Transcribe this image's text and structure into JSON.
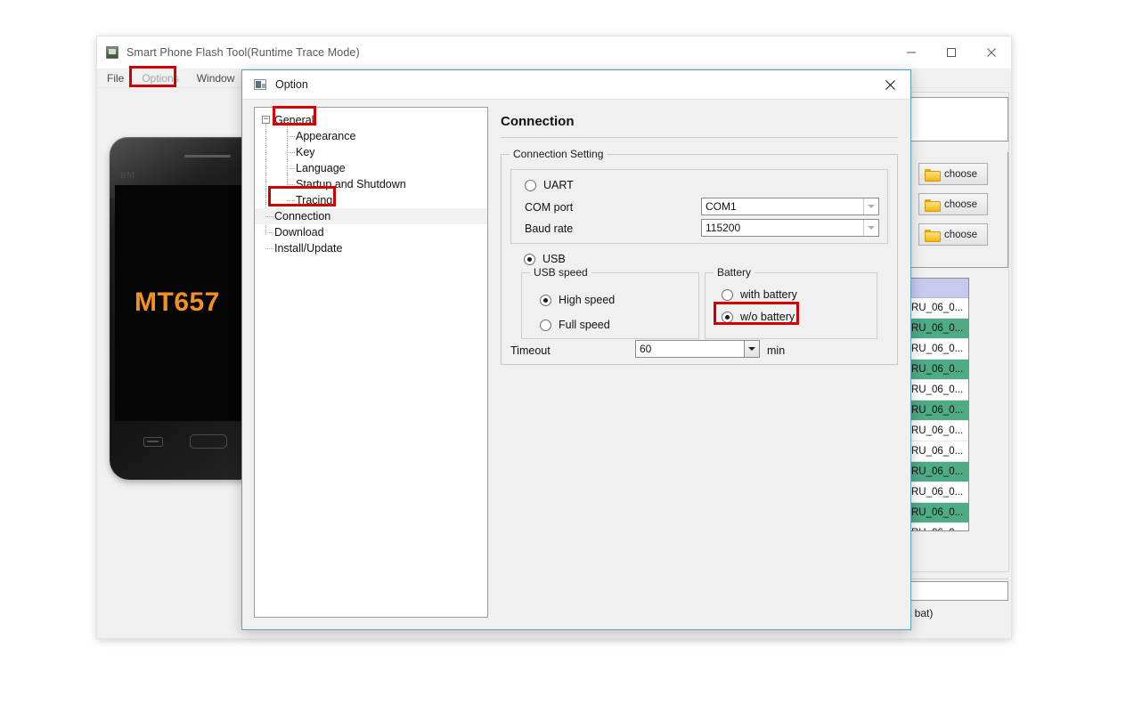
{
  "main_window": {
    "title": "Smart Phone Flash Tool(Runtime Trace Mode)",
    "icon": "app-icon",
    "controls": {
      "minimize": "minimize-icon",
      "maximize": "maximize-icon",
      "close": "close-icon"
    },
    "menu": [
      {
        "label": "File",
        "state": "normal"
      },
      {
        "label": "Options",
        "state": "active-highlighted"
      },
      {
        "label": "Window",
        "state": "normal"
      }
    ],
    "phone": {
      "brand": "BM",
      "model_text": "MT657"
    },
    "right_panel": {
      "choose_buttons": [
        {
          "label": "choose",
          "icon": "folder-icon"
        },
        {
          "label": "choose",
          "icon": "folder-icon"
        },
        {
          "label": "choose",
          "icon": "folder-icon"
        }
      ],
      "list_rows": [
        {
          "text": "RU_06_0...",
          "highlight": "white"
        },
        {
          "text": "RU_06_0...",
          "highlight": "green"
        },
        {
          "text": "RU_06_0...",
          "highlight": "white"
        },
        {
          "text": "RU_06_0...",
          "highlight": "green"
        },
        {
          "text": "RU_06_0...",
          "highlight": "white"
        },
        {
          "text": "RU_06_0...",
          "highlight": "green"
        },
        {
          "text": "RU_06_0...",
          "highlight": "white"
        },
        {
          "text": "RU_06_0...",
          "highlight": "white"
        },
        {
          "text": "RU_06_0...",
          "highlight": "green"
        },
        {
          "text": "RU_06_0...",
          "highlight": "white"
        },
        {
          "text": "RU_06_0...",
          "highlight": "green"
        },
        {
          "text": "RU_06_0...",
          "highlight": "white"
        }
      ],
      "status_text": "t bat)"
    }
  },
  "dialog": {
    "title": "Option",
    "icon": "option-icon",
    "close_label": "close-icon",
    "tree": [
      {
        "label": "General",
        "level": 0,
        "expander": "-",
        "highlighted": true
      },
      {
        "label": "Appearance",
        "level": 1
      },
      {
        "label": "Key",
        "level": 1
      },
      {
        "label": "Language",
        "level": 1
      },
      {
        "label": "Startup and Shutdown",
        "level": 1
      },
      {
        "label": "Tracing",
        "level": 1
      },
      {
        "label": "Connection",
        "level": 0,
        "selected": true,
        "highlighted": true
      },
      {
        "label": "Download",
        "level": 0
      },
      {
        "label": "Install/Update",
        "level": 0
      }
    ],
    "content": {
      "heading": "Connection",
      "connection_setting_legend": "Connection Setting",
      "uart": {
        "label": "UART",
        "selected": false,
        "com_port_label": "COM port",
        "com_port_value": "COM1",
        "baud_rate_label": "Baud rate",
        "baud_rate_value": "115200"
      },
      "usb": {
        "label": "USB",
        "selected": true,
        "speed_legend": "USB speed",
        "speed_options": [
          {
            "label": "High speed",
            "selected": true
          },
          {
            "label": "Full speed",
            "selected": false
          }
        ],
        "battery_legend": "Battery",
        "battery_options": [
          {
            "label": "with battery",
            "selected": false,
            "highlighted": false
          },
          {
            "label": "w/o battery",
            "selected": true,
            "highlighted": true
          }
        ]
      },
      "timeout": {
        "label": "Timeout",
        "value": "60",
        "unit": "min"
      }
    }
  },
  "colors": {
    "highlight_red": "#d00000",
    "dialog_border": "#5ba4b5",
    "accent_orange": "#f09223",
    "list_green": "#4eab86",
    "list_header_lavender": "#c9c8ee"
  }
}
